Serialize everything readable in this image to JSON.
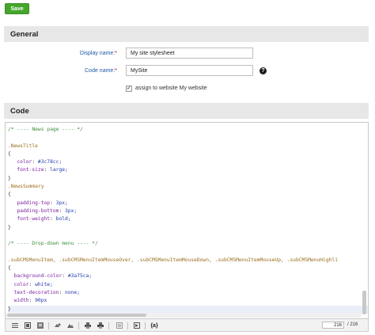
{
  "actions": {
    "save_label": "Save"
  },
  "sections": {
    "general": "General",
    "code": "Code"
  },
  "form": {
    "display_name_label": "Display name:",
    "display_name_value": "My site stylesheet",
    "code_name_label": "Code name:",
    "code_name_value": "MySite",
    "required_marker": "*",
    "help_glyph": "?",
    "assign_checked": true,
    "assign_label": "assign to website My website"
  },
  "editor": {
    "lines": [
      "/* ---- News page ---- */",
      "",
      ".NewsTitle",
      "{",
      "   color: #3c78cc;",
      "   font-size: large;",
      "}",
      ".NewsSummary",
      "{",
      "   padding-top: 3px;",
      "   padding-bottom: 3px;",
      "   font-weight: bold;",
      "}",
      "",
      "/* ---- Drop-down menu ---- */",
      "",
      ".subCMSMenuItem, .subCMSMenuItemMouseOver, .subCMSMenuItemMouseDown, .subCMSMenuItemMouseUp, .subCMSMenuHighli",
      "{",
      "  background-color: #3a75ca;",
      "  color: white;",
      "  text-decoration: none;",
      "  width: 90px",
      "}"
    ],
    "current_line": "216",
    "total_lines": "/ 216"
  },
  "toolbar": {
    "icons": [
      "list-icon",
      "select-all-icon",
      "format-icon",
      "search-icon",
      "replace-icon",
      "print-icon",
      "print-preview-icon",
      "fullscreen-icon",
      "toggle-icon",
      "brackets-icon"
    ]
  }
}
